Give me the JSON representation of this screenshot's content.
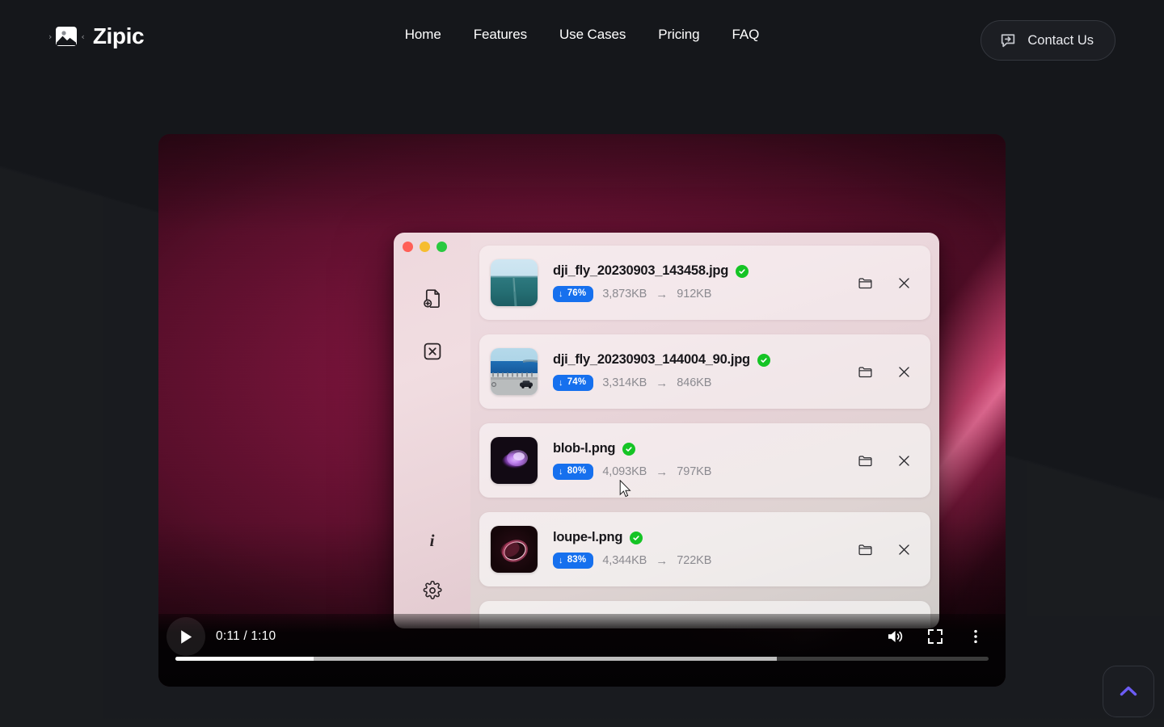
{
  "header": {
    "brand": {
      "name": "Zipic",
      "logo_icon": "image-compress-icon",
      "left_chevron": "›",
      "right_chevron": "‹"
    },
    "nav": [
      {
        "label": "Home",
        "name": "nav-link-home"
      },
      {
        "label": "Features",
        "name": "nav-link-features"
      },
      {
        "label": "Use Cases",
        "name": "nav-link-use-cases"
      },
      {
        "label": "Pricing",
        "name": "nav-link-pricing"
      },
      {
        "label": "FAQ",
        "name": "nav-link-faq"
      }
    ],
    "contact": {
      "label": "Contact Us",
      "icon": "chat-arrow-icon"
    }
  },
  "video": {
    "controls": {
      "play_icon": "play-icon",
      "time": "0:11 / 1:10",
      "current_time": "0:11",
      "duration": "1:10",
      "volume_icon": "volume-high-icon",
      "fullscreen_icon": "fullscreen-icon",
      "more_icon": "more-vertical-icon",
      "progress_played_pct": 17,
      "progress_buffered_pct": 74
    }
  },
  "app": {
    "sidebar": {
      "traffic_lights": [
        {
          "name": "close-window-button",
          "color": "#ff5f57"
        },
        {
          "name": "minimize-window-button",
          "color": "#f6bd30"
        },
        {
          "name": "maximize-window-button",
          "color": "#29c93f"
        }
      ],
      "items": [
        {
          "icon": "file-add-icon",
          "name": "sidebar-add-files-button"
        },
        {
          "icon": "clear-all-icon",
          "name": "sidebar-clear-all-button"
        },
        {
          "icon": "info-icon",
          "name": "sidebar-info-button",
          "glyph": "i"
        },
        {
          "icon": "gear-icon",
          "name": "sidebar-settings-button"
        }
      ]
    },
    "files": [
      {
        "name": "dji_fly_20230903_143458.jpg",
        "status": "done",
        "reduction": "76%",
        "size_before": "3,873KB",
        "size_after": "912KB",
        "arrow": "→",
        "thumb": "drone-pier-photo"
      },
      {
        "name": "dji_fly_20230903_144004_90.jpg",
        "status": "done",
        "reduction": "74%",
        "size_before": "3,314KB",
        "size_after": "846KB",
        "arrow": "→",
        "thumb": "coast-road-photo"
      },
      {
        "name": "blob-l.png",
        "status": "done",
        "reduction": "80%",
        "size_before": "4,093KB",
        "size_after": "797KB",
        "arrow": "→",
        "thumb": "purple-blob-graphic"
      },
      {
        "name": "loupe-l.png",
        "status": "done",
        "reduction": "83%",
        "size_before": "4,344KB",
        "size_after": "722KB",
        "arrow": "→",
        "thumb": "pink-loupe-graphic"
      }
    ],
    "row_actions": {
      "reveal_icon": "folder-icon",
      "remove_icon": "close-icon"
    }
  },
  "scroll_top": {
    "icon": "chevron-up-icon",
    "color": "#6c5cf5"
  },
  "colors": {
    "page_bg": "#15171b",
    "accent_blue": "#1670ee",
    "accent_green": "#15c425",
    "accent_purple": "#6c5cf5",
    "video_bg_crimson": "#6d1235",
    "video_streak_pink": "#f778a2"
  }
}
